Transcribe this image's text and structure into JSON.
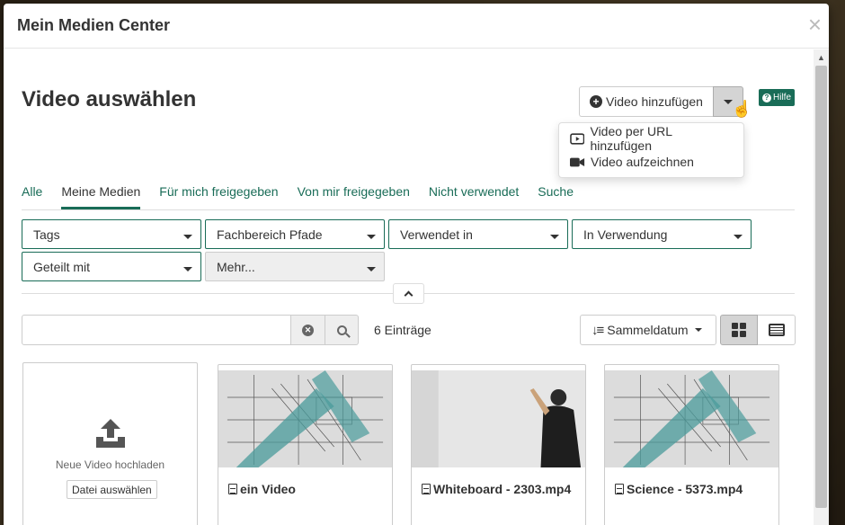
{
  "modal": {
    "title": "Mein Medien Center",
    "close_label": "×"
  },
  "header": {
    "page_title": "Video auswählen",
    "add_button_label": "Video hinzufügen",
    "help_label": "Hilfe"
  },
  "add_menu": {
    "items": [
      {
        "label": "Video per URL hinzufügen",
        "icon": "video-url-icon"
      },
      {
        "label": "Video aufzeichnen",
        "icon": "video-camera-icon"
      }
    ]
  },
  "tabs": [
    {
      "label": "Alle",
      "active": false
    },
    {
      "label": "Meine Medien",
      "active": true
    },
    {
      "label": "Für mich freigegeben",
      "active": false
    },
    {
      "label": "Von mir freigegeben",
      "active": false
    },
    {
      "label": "Nicht verwendet",
      "active": false
    },
    {
      "label": "Suche",
      "active": false
    }
  ],
  "filters": [
    {
      "label": "Tags"
    },
    {
      "label": "Fachbereich Pfade"
    },
    {
      "label": "Verwendet in"
    },
    {
      "label": "In Verwendung"
    },
    {
      "label": "Geteilt mit"
    },
    {
      "label": "Mehr..."
    }
  ],
  "search": {
    "value": "",
    "placeholder": ""
  },
  "result_count": "6 Einträge",
  "sort": {
    "label": "Sammeldatum"
  },
  "upload": {
    "label": "Neue Video hochladen",
    "button_label": "Datei auswählen"
  },
  "videos": [
    {
      "title": "ein Video",
      "thumb": "technical-drawing"
    },
    {
      "title": "Whiteboard - 2303.mp4",
      "thumb": "whiteboard-photo"
    },
    {
      "title": "Science - 5373.mp4",
      "thumb": "technical-drawing"
    }
  ],
  "colors": {
    "accent": "#196c57",
    "border": "#cccccc"
  }
}
